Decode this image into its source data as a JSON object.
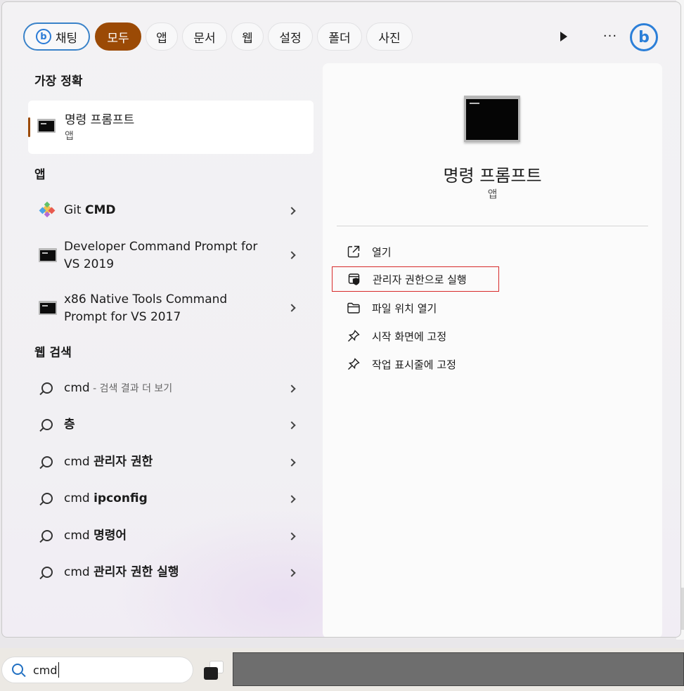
{
  "filters": {
    "chat_label": "채팅",
    "bing_letter": "b",
    "items": [
      "모두",
      "앱",
      "문서",
      "웹",
      "설정",
      "폴더",
      "사진"
    ],
    "active_color": "#9b4a05",
    "chat_border_color": "#3a83c9",
    "more_label": "···"
  },
  "best_match": {
    "section_title": "가장 정확",
    "name": "명령 프롬프트",
    "type": "앱"
  },
  "apps": {
    "section_title": "앱",
    "items": [
      {
        "prefix": "Git ",
        "bold": "CMD",
        "icon": "git-icon"
      },
      {
        "line1": "Developer Command Prompt for",
        "line2": "VS 2019",
        "icon": "cmd-icon"
      },
      {
        "line1": "x86 Native Tools Command",
        "line2": "Prompt for VS 2017",
        "icon": "cmd-icon"
      }
    ]
  },
  "web": {
    "section_title": "웹 검색",
    "items": [
      {
        "prefix": "cmd",
        "suffix": " - 검색 결과 더 보기"
      },
      {
        "prefix": "",
        "bold": "층"
      },
      {
        "prefix": "cmd ",
        "bold": "관리자 권한"
      },
      {
        "prefix": "cmd ",
        "bold": "ipconfig"
      },
      {
        "prefix": "cmd ",
        "bold": "명령어"
      },
      {
        "prefix": "cmd ",
        "bold": "관리자 권한 실행"
      }
    ]
  },
  "preview": {
    "title": "명령 프롬프트",
    "type": "앱",
    "actions": [
      {
        "label": "열기",
        "icon": "open-external-icon"
      },
      {
        "label": "관리자 권한으로 실행",
        "icon": "shield-admin-icon",
        "highlight_color": "#d72b2b"
      },
      {
        "label": "파일 위치 열기",
        "icon": "folder-icon"
      },
      {
        "label": "시작 화면에 고정",
        "icon": "pin-icon"
      },
      {
        "label": "작업 표시줄에 고정",
        "icon": "pin-icon"
      }
    ]
  },
  "taskbar": {
    "search_value": "cmd"
  }
}
